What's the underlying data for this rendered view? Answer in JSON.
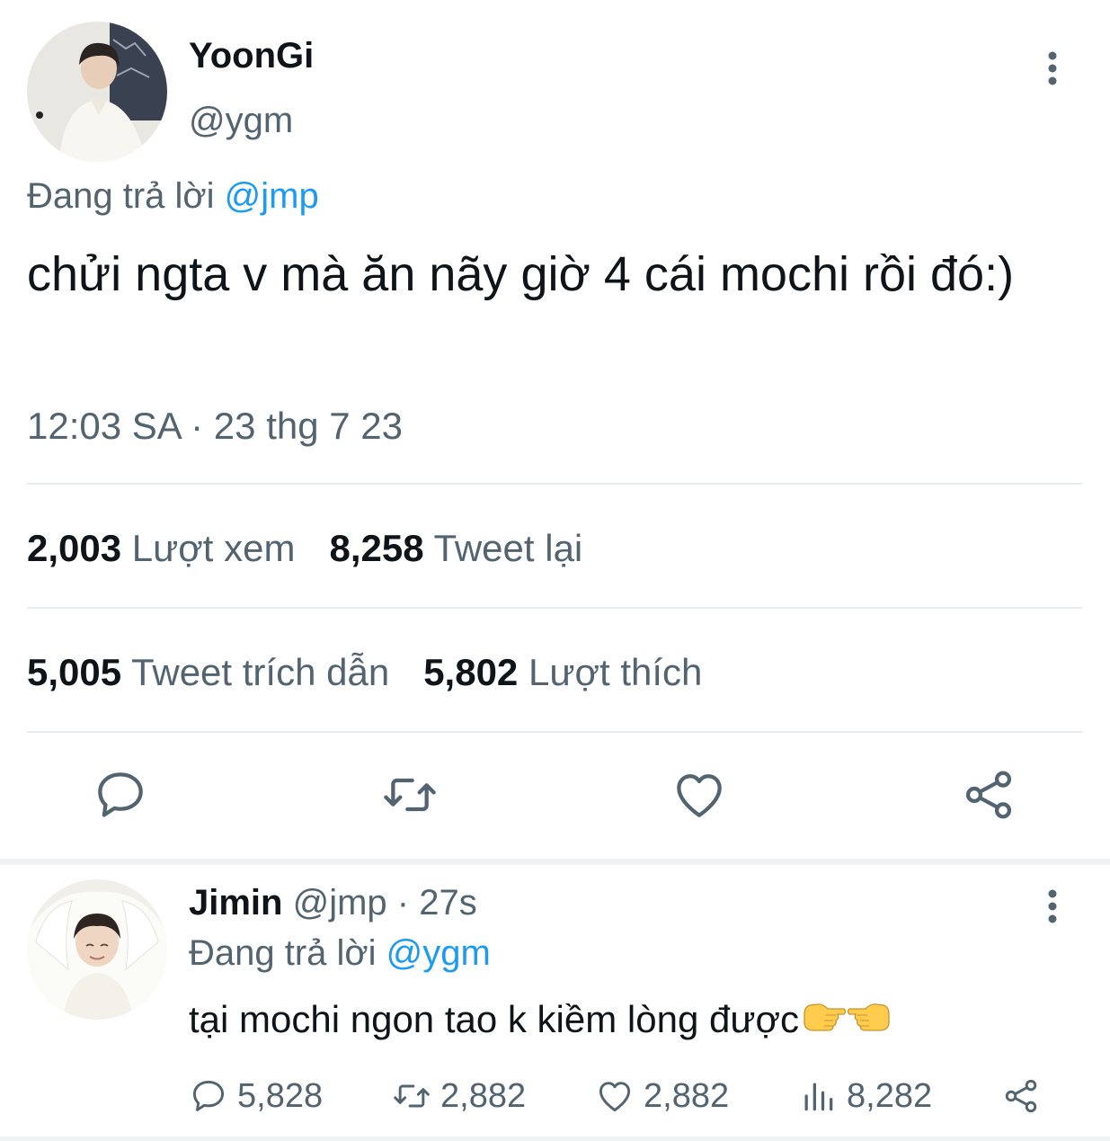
{
  "tweet": {
    "author": {
      "name": "YoonGi",
      "handle": "@ygm"
    },
    "reply_prefix": "Đang trả lời",
    "reply_mention": "@jmp",
    "text": "chửi ngta v mà ăn nãy giờ 4 cái mochi rồi đó:)",
    "timestamp": "12:03 SA · 23 thg 7 23",
    "stats": {
      "views": {
        "count": "2,003",
        "label": "Lượt xem"
      },
      "retweets": {
        "count": "8,258",
        "label": "Tweet lại"
      },
      "quotes": {
        "count": "5,005",
        "label": "Tweet trích dẫn"
      },
      "likes": {
        "count": "5,802",
        "label": "Lượt thích"
      }
    },
    "actions": [
      "reply-icon",
      "retweet-icon",
      "heart-icon",
      "share-icon"
    ]
  },
  "reply": {
    "author": {
      "name": "Jimin",
      "handle": "@jmp",
      "time": "· 27s"
    },
    "reply_prefix": "Đang trả lời",
    "reply_mention": "@ygm",
    "text": "tại mochi ngon tao k kiềm lòng được",
    "emojis": [
      "backhand-index-pointing-left",
      "backhand-index-pointing-right"
    ],
    "actions": {
      "replies": "5,828",
      "retweets": "2,882",
      "likes": "2,882",
      "views": "8,282"
    }
  },
  "colors": {
    "text": "#0f1419",
    "secondary": "#536471",
    "accent": "#1d9bf0",
    "divider": "#e6ecf0"
  }
}
